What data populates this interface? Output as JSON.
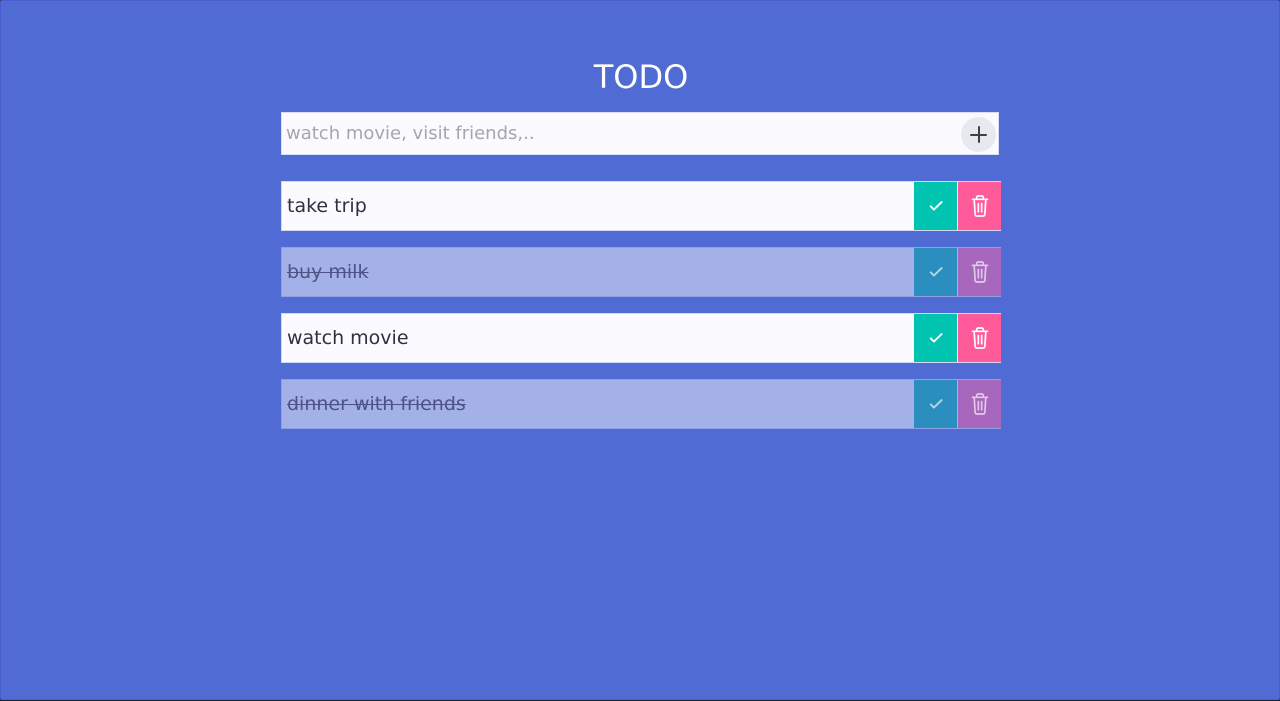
{
  "app": {
    "title": "TODO",
    "accent_color": "#516bd5"
  },
  "input": {
    "placeholder": "watch movie, visit friends,..",
    "value": "",
    "add_icon": "plus-icon"
  },
  "todos": [
    {
      "label": "take trip",
      "completed": false,
      "complete_icon": "check-icon",
      "delete_icon": "trash-icon"
    },
    {
      "label": "buy milk",
      "completed": true,
      "complete_icon": "check-icon",
      "delete_icon": "trash-icon"
    },
    {
      "label": "watch movie",
      "completed": false,
      "complete_icon": "check-icon",
      "delete_icon": "trash-icon"
    },
    {
      "label": "dinner with friends",
      "completed": true,
      "complete_icon": "check-icon",
      "delete_icon": "trash-icon"
    }
  ],
  "colors": {
    "background": "#516bd5",
    "card_active": "#fbfbff",
    "card_done": "#a4b1e8",
    "complete_button": "#00c4b0",
    "delete_button": "#ff5b9a",
    "complete_button_done": "#2a8fbe",
    "delete_button_done": "#a767bc"
  }
}
